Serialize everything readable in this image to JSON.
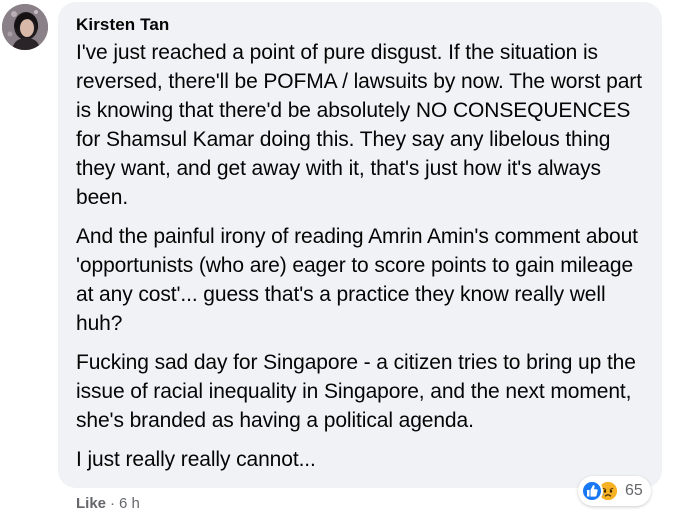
{
  "comment": {
    "author": "Kirsten Tan",
    "paragraphs": [
      "I've just reached a point of pure disgust. If the situation is reversed, there'll be POFMA / lawsuits by now. The worst part is knowing that there'd be absolutely NO CONSEQUENCES for Shamsul Kamar doing this. They say any libelous thing they want, and get away with it, that's just how it's always been.",
      "And the painful irony of reading Amrin Amin's comment about 'opportunists (who are) eager to score points to gain mileage at any cost'... guess that's a practice they know really well huh?",
      "Fucking sad day for Singapore - a citizen tries to bring up the issue of racial inequality in Singapore, and the next moment, she's branded as having a political agenda.",
      "I just really really cannot..."
    ],
    "reactions": {
      "icons": [
        "like-icon",
        "sad-icon"
      ],
      "count": "65"
    },
    "actions": {
      "like_label": "Like",
      "separator": "·",
      "timestamp": "6 h"
    }
  },
  "colors": {
    "bubble_bg": "#f0f2f5",
    "text": "#050505",
    "secondary_text": "#65676b",
    "like_blue": "#1877f2",
    "sad_yellow": "#f7b125"
  }
}
